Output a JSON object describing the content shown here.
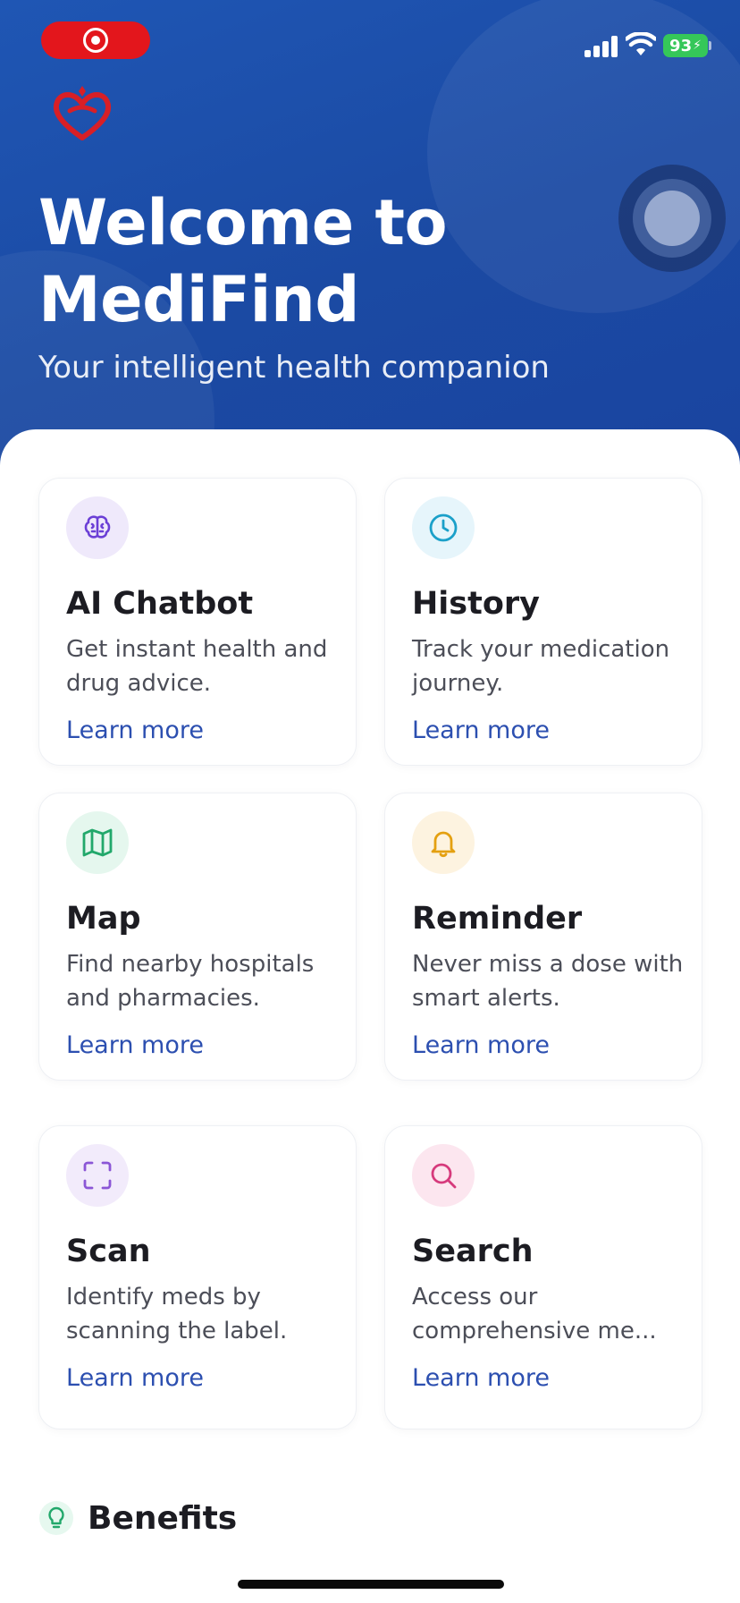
{
  "status_bar": {
    "battery": "93"
  },
  "hero": {
    "title": "Welcome to MediFind",
    "subtitle": "Your intelligent health companion"
  },
  "features": [
    {
      "title": "AI Chatbot",
      "description": "Get instant health and drug advice.",
      "link": "Learn more",
      "icon": "brain-icon",
      "accent": "#6b3fd6",
      "bg": "#efe9fb"
    },
    {
      "title": "History",
      "description": "Track your medication journey.",
      "link": "Learn more",
      "icon": "clock-icon",
      "accent": "#1ba0c9",
      "bg": "#e6f5fb"
    },
    {
      "title": "Map",
      "description": "Find nearby hospitals and pharmacies.",
      "link": "Learn more",
      "icon": "map-icon",
      "accent": "#22a86b",
      "bg": "#e5f7ee"
    },
    {
      "title": "Reminder",
      "description": "Never miss a dose with smart alerts.",
      "link": "Learn more",
      "icon": "bell-icon",
      "accent": "#e4a011",
      "bg": "#fdf3e0"
    },
    {
      "title": "Scan",
      "description": "Identify meds by scanning the label.",
      "link": "Learn more",
      "icon": "scan-icon",
      "accent": "#8b56d6",
      "bg": "#f2ebfb"
    },
    {
      "title": "Search",
      "description": "Access our comprehensive me...",
      "link": "Learn more",
      "icon": "search-icon",
      "accent": "#d63a7c",
      "bg": "#fce6ef"
    }
  ],
  "benefits": {
    "title": "Benefits",
    "icon": "lightbulb-icon",
    "accent": "#22a86b"
  },
  "colors": {
    "primary": "#1f56b4",
    "link": "#2c4fb0",
    "recording": "#e3161c",
    "battery": "#35c759"
  }
}
